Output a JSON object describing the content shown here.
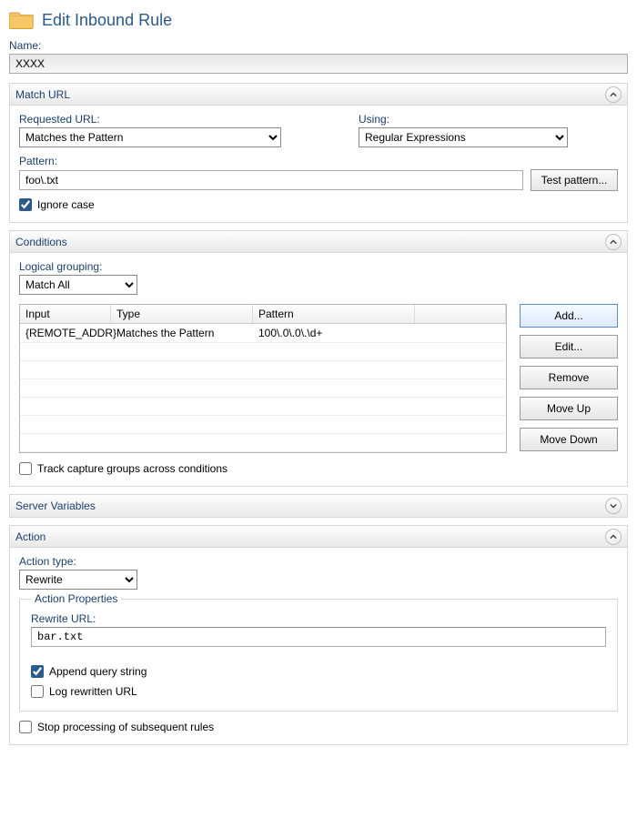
{
  "header": {
    "title": "Edit Inbound Rule"
  },
  "name": {
    "label": "Name:",
    "value": "XXXX"
  },
  "match_url": {
    "panel_title": "Match URL",
    "requested_url_label": "Requested URL:",
    "requested_url_value": "Matches the Pattern",
    "using_label": "Using:",
    "using_value": "Regular Expressions",
    "pattern_label": "Pattern:",
    "pattern_value": "foo\\.txt",
    "test_pattern_btn": "Test pattern...",
    "ignore_case_label": "Ignore case",
    "ignore_case_checked": true
  },
  "conditions": {
    "panel_title": "Conditions",
    "logical_grouping_label": "Logical grouping:",
    "logical_grouping_value": "Match All",
    "columns": {
      "input": "Input",
      "type": "Type",
      "pattern": "Pattern"
    },
    "rows": [
      {
        "input": "{REMOTE_ADDR}",
        "type": "Matches the Pattern",
        "pattern": "100\\.0\\.0\\.\\d+"
      }
    ],
    "buttons": {
      "add": "Add...",
      "edit": "Edit...",
      "remove": "Remove",
      "move_up": "Move Up",
      "move_down": "Move Down"
    },
    "track_capture_label": "Track capture groups across conditions",
    "track_capture_checked": false
  },
  "server_variables": {
    "panel_title": "Server Variables"
  },
  "action": {
    "panel_title": "Action",
    "action_type_label": "Action type:",
    "action_type_value": "Rewrite",
    "action_properties_legend": "Action Properties",
    "rewrite_url_label": "Rewrite URL:",
    "rewrite_url_value": "bar.txt",
    "append_query_label": "Append query string",
    "append_query_checked": true,
    "log_rewritten_label": "Log rewritten URL",
    "log_rewritten_checked": false,
    "stop_processing_label": "Stop processing of subsequent rules",
    "stop_processing_checked": false
  }
}
